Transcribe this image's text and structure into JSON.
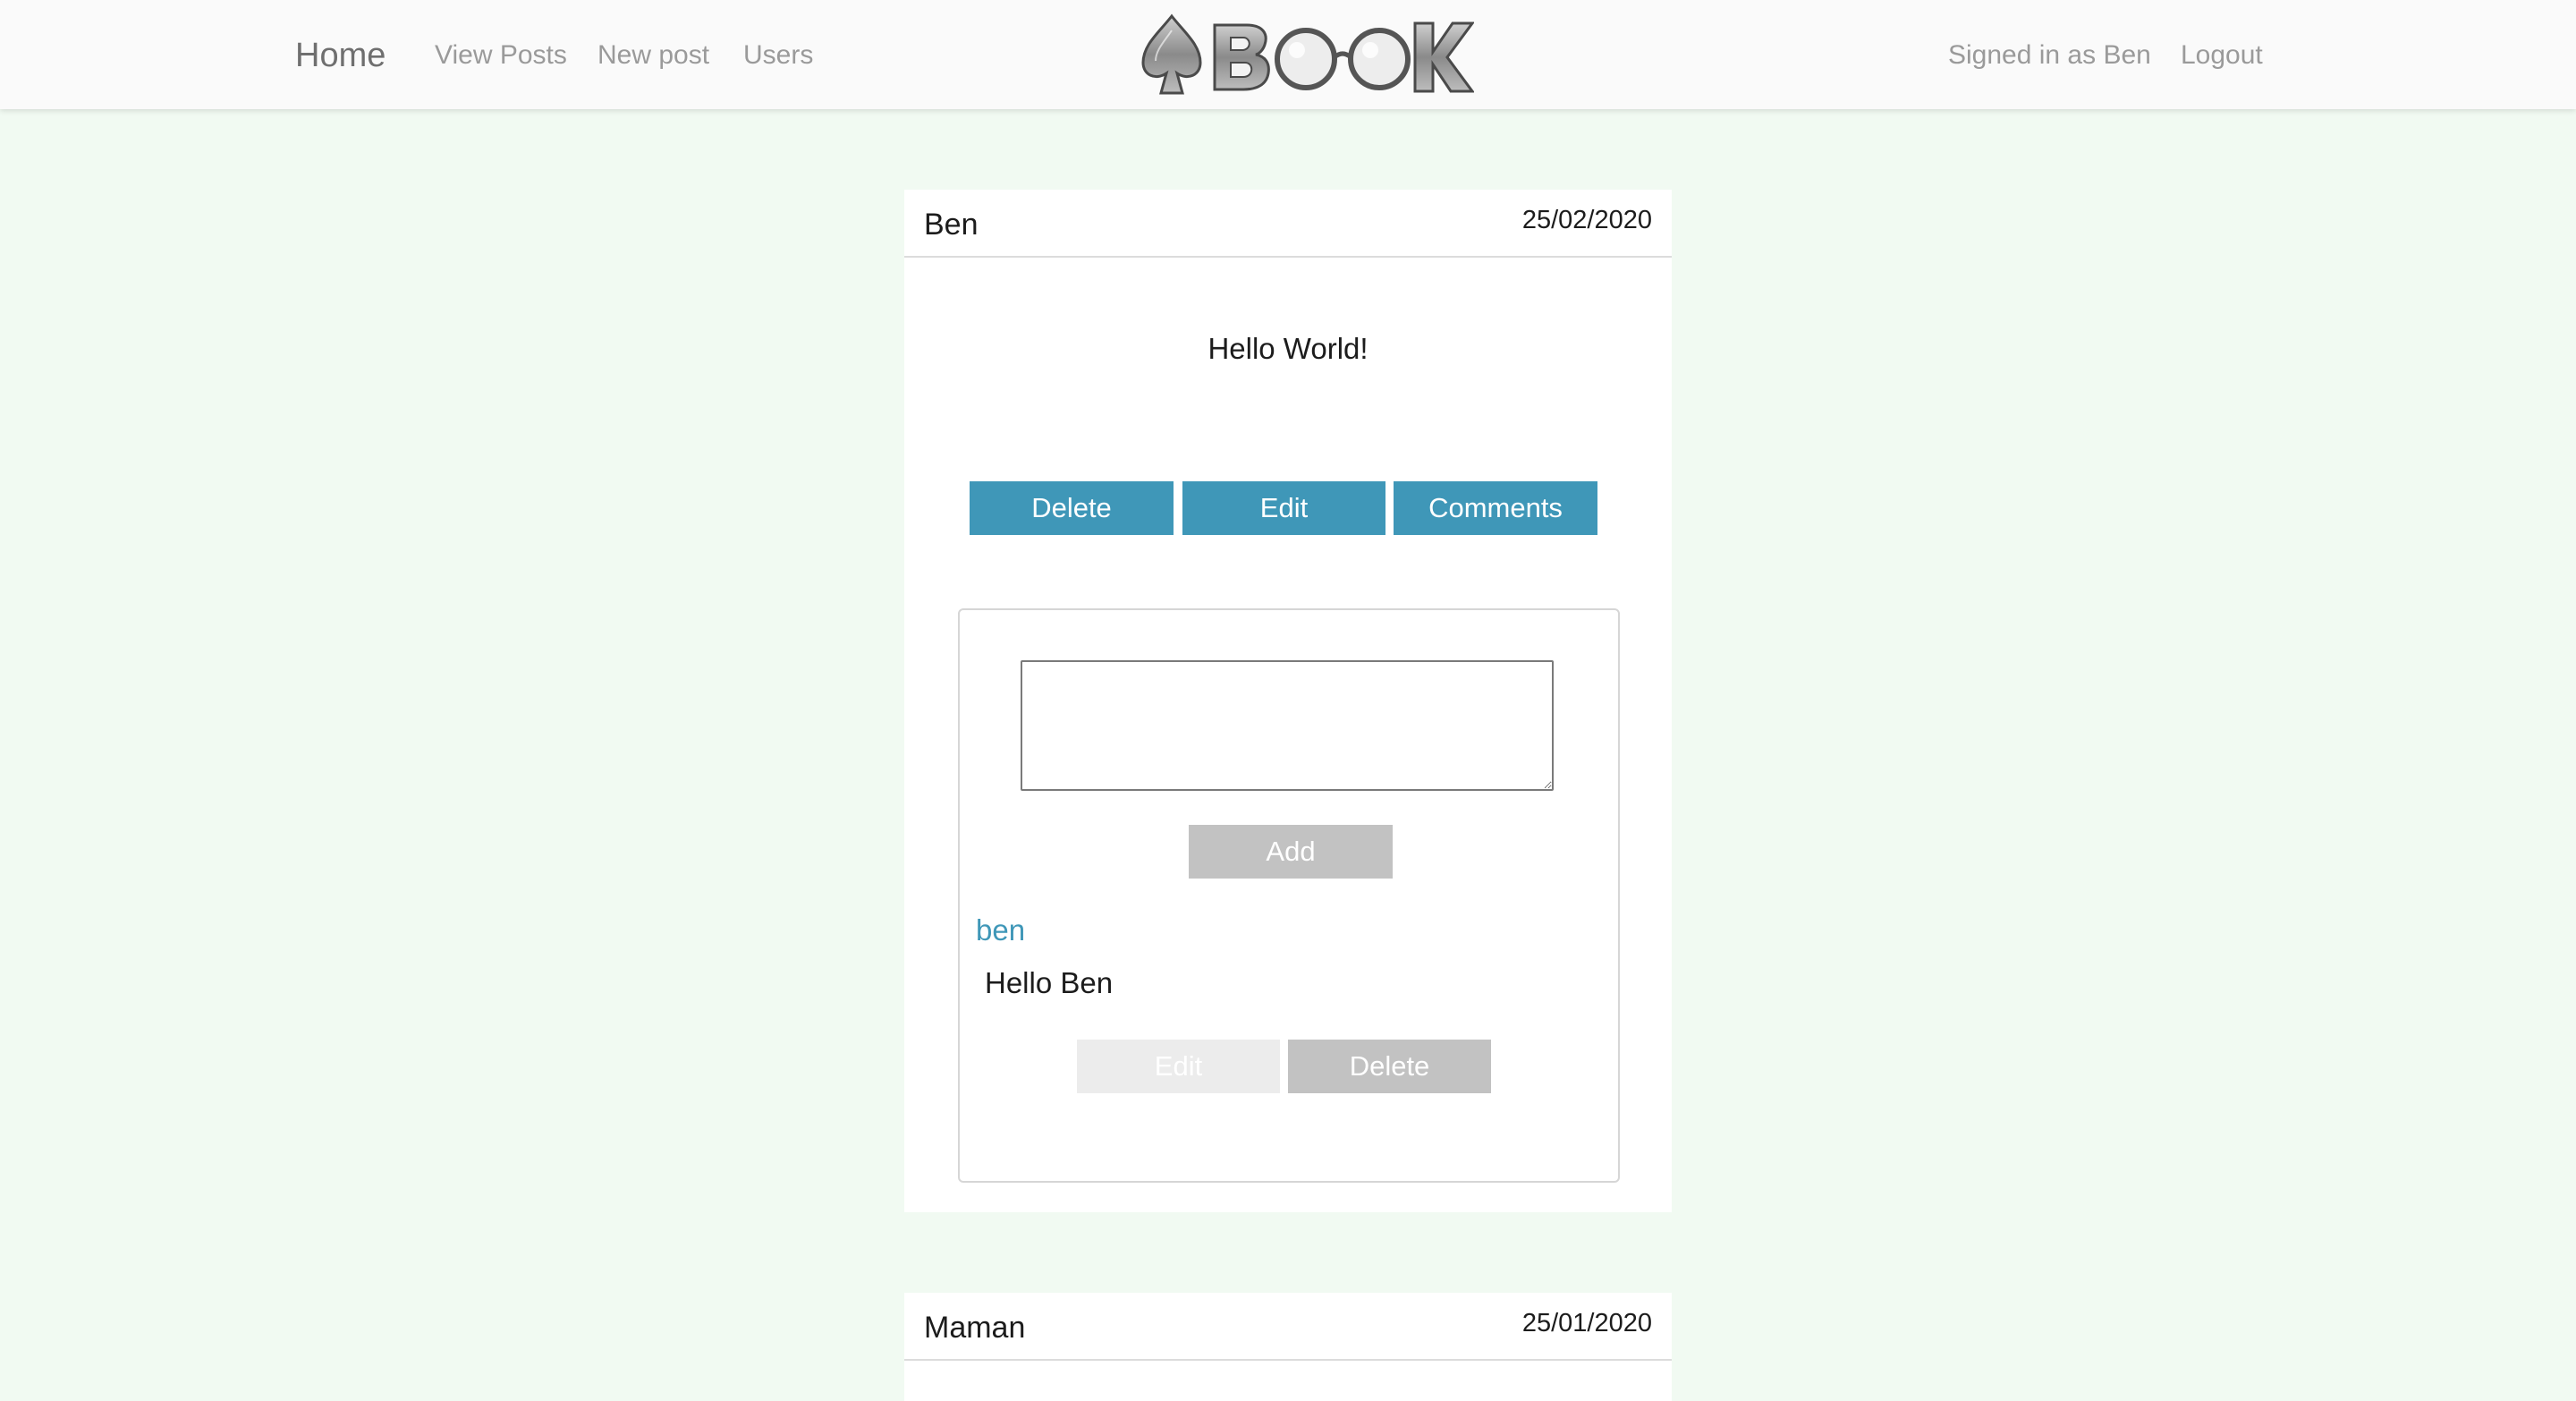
{
  "navbar": {
    "brand": "Home",
    "links": [
      "View Posts",
      "New post",
      "Users"
    ],
    "signed_in": "Signed in as Ben",
    "logout": "Logout",
    "logo_text": "BOOK"
  },
  "colors": {
    "background": "#f1faf2",
    "primary_button": "#3f97b8",
    "disabled_button": "#c2c2c2",
    "link": "#3f97b8"
  },
  "posts": [
    {
      "author": "Ben",
      "date": "25/02/2020",
      "body": "Hello World!",
      "actions": [
        "Delete",
        "Edit",
        "Comments"
      ],
      "comment_form": {
        "placeholder": "",
        "add_label": "Add"
      },
      "comments": [
        {
          "author": "ben",
          "text": "Hello Ben",
          "actions": [
            "Edit",
            "Delete"
          ]
        }
      ]
    },
    {
      "author": "Maman",
      "date": "25/01/2020"
    }
  ]
}
